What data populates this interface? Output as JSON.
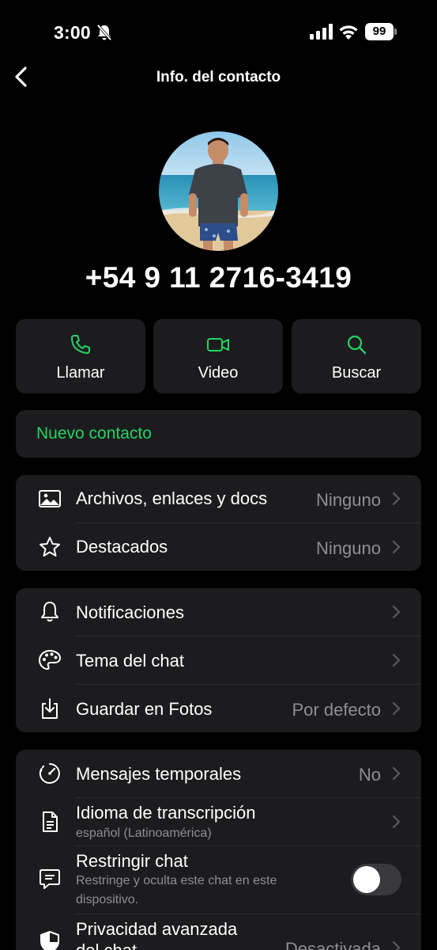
{
  "status_bar": {
    "time": "3:00",
    "battery": "99"
  },
  "nav": {
    "title": "Info. del contacto"
  },
  "contact": {
    "phone": "+54 9 11 2716-3419"
  },
  "actions": [
    {
      "label": "Llamar",
      "icon": "phone-icon"
    },
    {
      "label": "Video",
      "icon": "video-icon"
    },
    {
      "label": "Buscar",
      "icon": "search-icon"
    }
  ],
  "new_contact_label": "Nuevo contacto",
  "media_section": [
    {
      "title": "Archivos, enlaces y docs",
      "value": "Ninguno",
      "icon": "image-icon"
    },
    {
      "title": "Destacados",
      "value": "Ninguno",
      "icon": "star-icon"
    }
  ],
  "settings_section": [
    {
      "title": "Notificaciones",
      "value": "",
      "icon": "bell-icon"
    },
    {
      "title": "Tema del chat",
      "value": "",
      "icon": "palette-icon"
    },
    {
      "title": "Guardar en Fotos",
      "value": "Por defecto",
      "icon": "save-icon"
    }
  ],
  "privacy_section": {
    "disappearing": {
      "title": "Mensajes temporales",
      "value": "No"
    },
    "transcription": {
      "title": "Idioma de transcripción",
      "subtitle": "español (Latinoamérica)"
    },
    "restrict": {
      "title": "Restringir chat",
      "subtitle_line1": "Restringe y oculta este chat en este",
      "subtitle_line2": "dispositivo.",
      "enabled": false
    },
    "advanced": {
      "title": "Privacidad avanzada",
      "title_line2": "del chat",
      "value": "Desactivada"
    }
  },
  "colors": {
    "accent": "#25d366",
    "card": "#1c1c1e",
    "secondary_text": "#8e8e93"
  }
}
